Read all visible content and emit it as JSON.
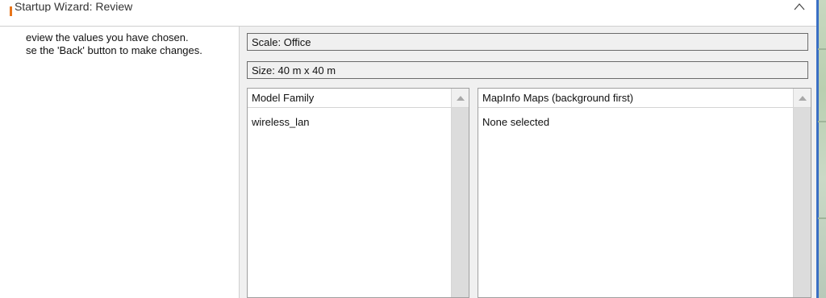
{
  "window": {
    "title": "Startup Wizard: Review"
  },
  "instructions": {
    "line1": "eview the values you have chosen.",
    "line2": "se the 'Back' button to make changes."
  },
  "summary": {
    "scale": "Scale: Office",
    "size": "Size: 40 m x 40 m"
  },
  "model_family_list": {
    "header": "Model Family",
    "items": [
      "wireless_lan"
    ]
  },
  "mapinfo_list": {
    "header": "MapInfo Maps (background first)",
    "items": [
      "None selected"
    ]
  },
  "colors": {
    "title_accent": "#e8751a",
    "field_border": "#6b6b6b",
    "panel_bg": "#f0f0f0"
  },
  "icons": {
    "title_caret": "chevron-up-icon",
    "scroll_up": "scroll-up-arrow-icon"
  }
}
